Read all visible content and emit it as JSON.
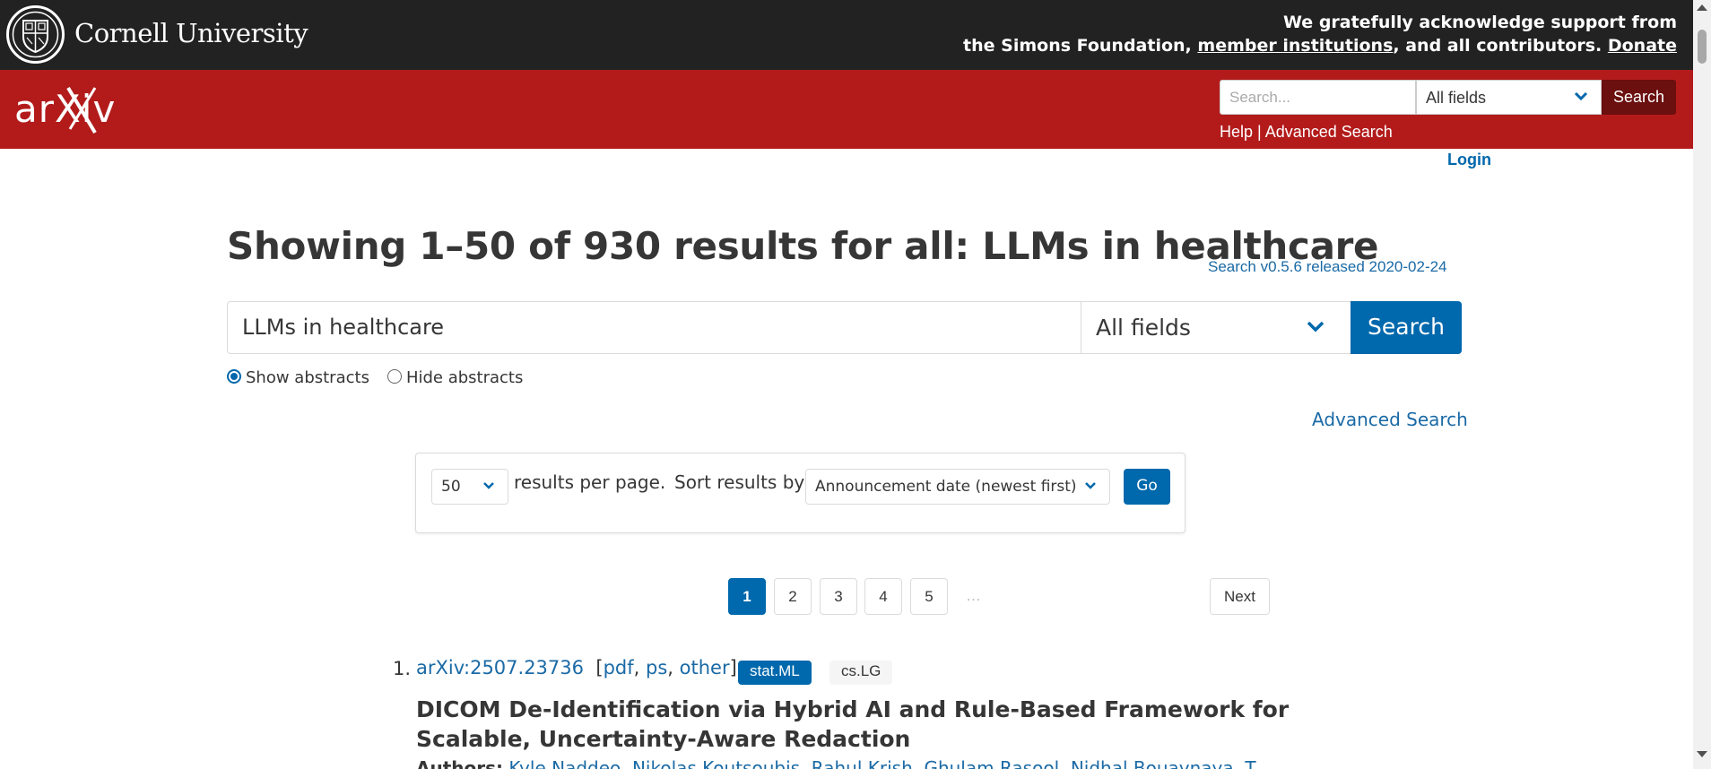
{
  "cornell": {
    "name": "Cornell University",
    "support_line1": "We gratefully acknowledge support from",
    "support_prefix": "the Simons Foundation, ",
    "member_link": "member institutions",
    "support_mid": ", and all contributors. ",
    "donate_link": "Donate"
  },
  "header": {
    "logo_text": "arXiv",
    "search_placeholder": "Search...",
    "field_select": "All fields",
    "search_button": "Search",
    "help_link": "Help",
    "separator": " | ",
    "advanced_link": "Advanced Search"
  },
  "login": "Login",
  "page": {
    "title": "Showing 1–50 of 930 results for all: LLMs in healthcare",
    "version": "Search v0.5.6 released 2020-02-24",
    "search_value": "LLMs in healthcare",
    "field_select": "All fields",
    "search_button": "Search",
    "show_abstracts": "Show abstracts",
    "hide_abstracts": "Hide abstracts",
    "advanced_search": "Advanced Search"
  },
  "options": {
    "per_page": "50",
    "per_page_text": "results per page.",
    "sort_text": "Sort results by",
    "sort_value": "Announcement date (newest first)",
    "go_button": "Go"
  },
  "pagination": {
    "pages": [
      "1",
      "2",
      "3",
      "4",
      "5"
    ],
    "current": "1",
    "ellipsis": "…",
    "next": "Next"
  },
  "results": [
    {
      "number": "1.",
      "id": "arXiv:2507.23736",
      "open_bracket": "[",
      "pdf": "pdf",
      "ps": "ps",
      "other": "other",
      "close_bracket": "]",
      "primary_tag": "stat.ML",
      "secondary_tag": "cs.LG",
      "title": "DICOM De-Identification via Hybrid AI and Rule-Based Framework for Scalable, Uncertainty-Aware Redaction",
      "authors_label": "Authors:",
      "authors": "Kyle Naddeo, Nikolas Koutsoubis, Rahul Krish, Ghulam Rasool, Nidhal Bouaynaya, T..."
    }
  ],
  "colors": {
    "cornell_bg": "#222222",
    "arxiv_red": "#b31b1b",
    "header_button": "#6b0f0f",
    "primary_blue": "#0068ac",
    "link_blue": "#1a6aa6"
  }
}
